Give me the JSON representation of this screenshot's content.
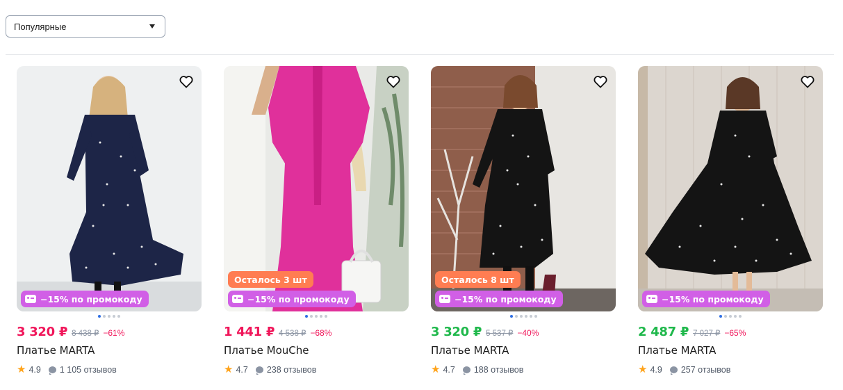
{
  "sort": {
    "selected": "Популярные"
  },
  "products": [
    {
      "price": "3 320 ₽",
      "old_price": "8 438 ₽",
      "discount": "−61%",
      "title": "Платье MARTA",
      "rating": "4.9",
      "reviews": "1 105 отзывов",
      "stock": null,
      "promo": "−15% по промокоду",
      "price_color": "pink"
    },
    {
      "price": "1 441 ₽",
      "old_price": "4 538 ₽",
      "discount": "−68%",
      "title": "Платье MouChe",
      "rating": "4.7",
      "reviews": "238 отзывов",
      "stock": "Осталось 3 шт",
      "promo": "−15% по промокоду",
      "price_color": "pink"
    },
    {
      "price": "3 320 ₽",
      "old_price": "5 537 ₽",
      "discount": "−40%",
      "title": "Платье MARTA",
      "rating": "4.7",
      "reviews": "188 отзывов",
      "stock": "Осталось 8 шт",
      "promo": "−15% по промокоду",
      "price_color": "green"
    },
    {
      "price": "2 487 ₽",
      "old_price": "7 027 ₽",
      "discount": "−65%",
      "title": "Платье MARTA",
      "rating": "4.9",
      "reviews": "257 отзывов",
      "stock": null,
      "promo": "−15% по промокоду",
      "price_color": "green"
    }
  ],
  "colors": {
    "accent_pink": "#f0165a",
    "accent_green": "#1fb84b",
    "stock_badge": "#ff7d52",
    "promo_badge": "#d15fe6",
    "carousel_active": "#2f6fe4"
  },
  "icons": [
    "heart-icon",
    "promo-ticket-icon",
    "star-icon",
    "chat-bubble-icon",
    "chevron-down-icon"
  ]
}
